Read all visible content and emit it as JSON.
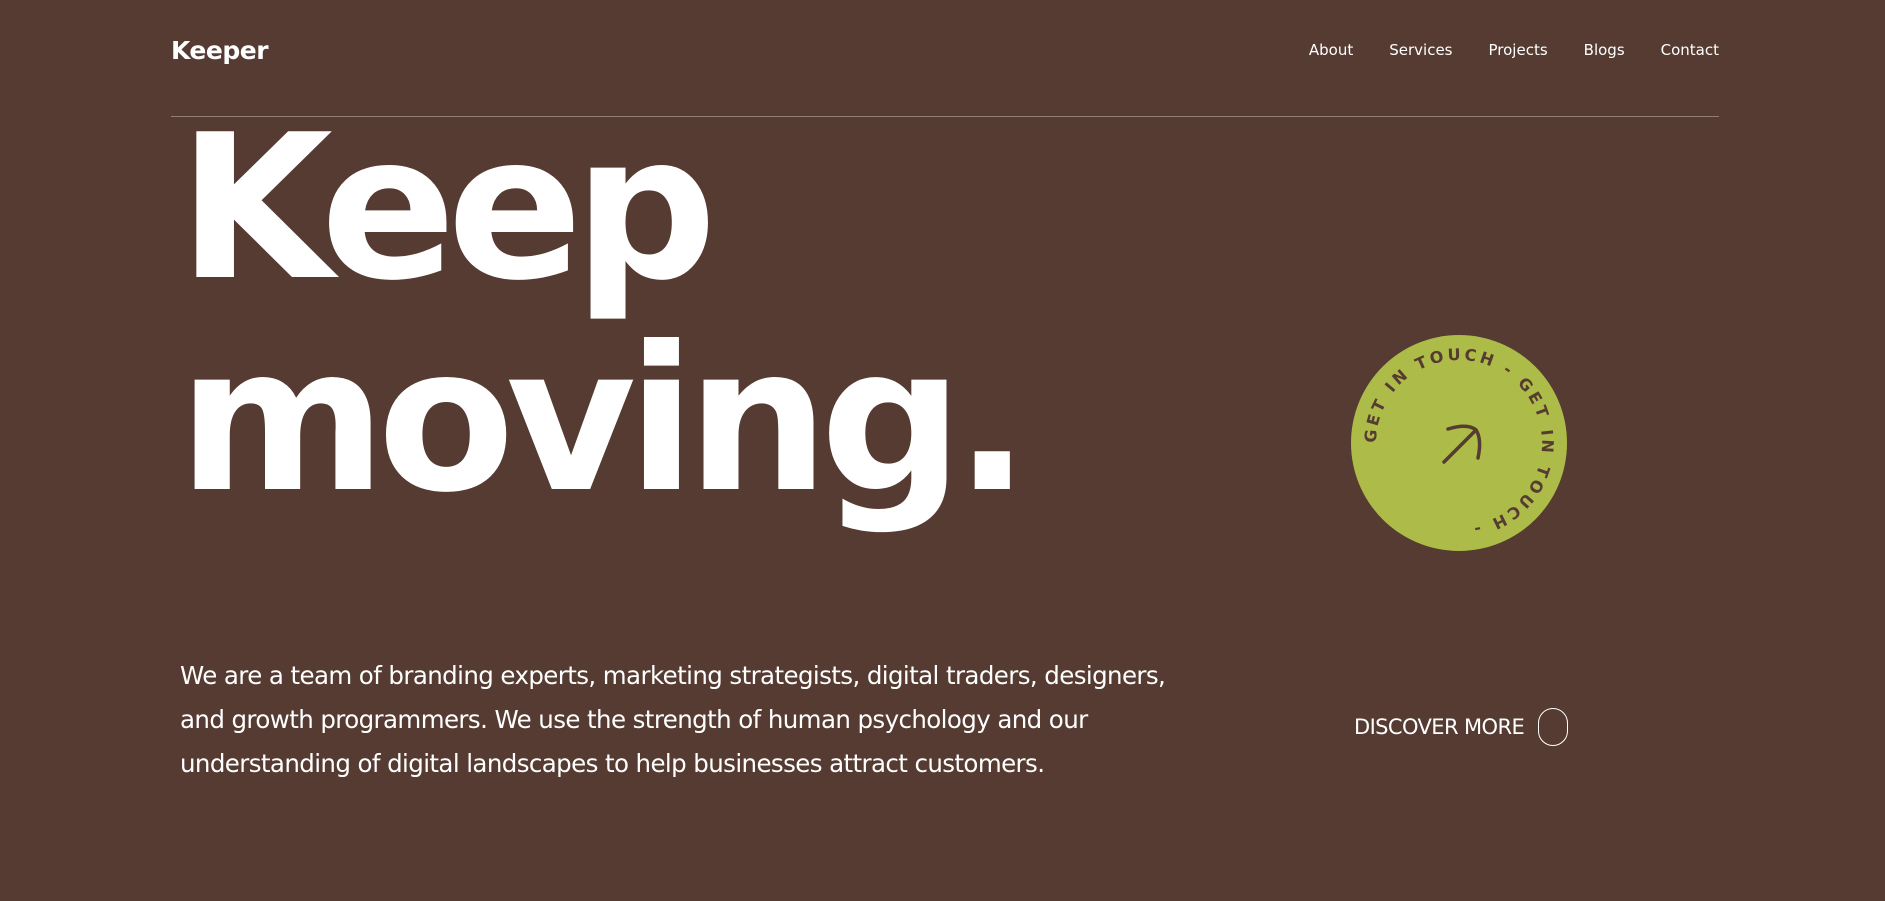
{
  "header": {
    "logo": "Keeper",
    "nav": [
      "About",
      "Services",
      "Projects",
      "Blogs",
      "Contact"
    ]
  },
  "hero": {
    "line1": "Keep",
    "line2": "moving."
  },
  "badge": {
    "text": "GET IN TOUCH - GET IN TOUCH - ",
    "icon": "arrow-up-right-icon",
    "color": "#adbb49"
  },
  "intro": {
    "text": "We are a team of branding experts, marketing strategists, digital traders, designers, and growth programmers. We use the strength of human psychology and our understanding of digital landscapes to help businesses attract customers."
  },
  "cta": {
    "label": "DISCOVER MORE"
  },
  "colors": {
    "background": "#553b32",
    "accent": "#adbb49",
    "text": "#ffffff"
  }
}
